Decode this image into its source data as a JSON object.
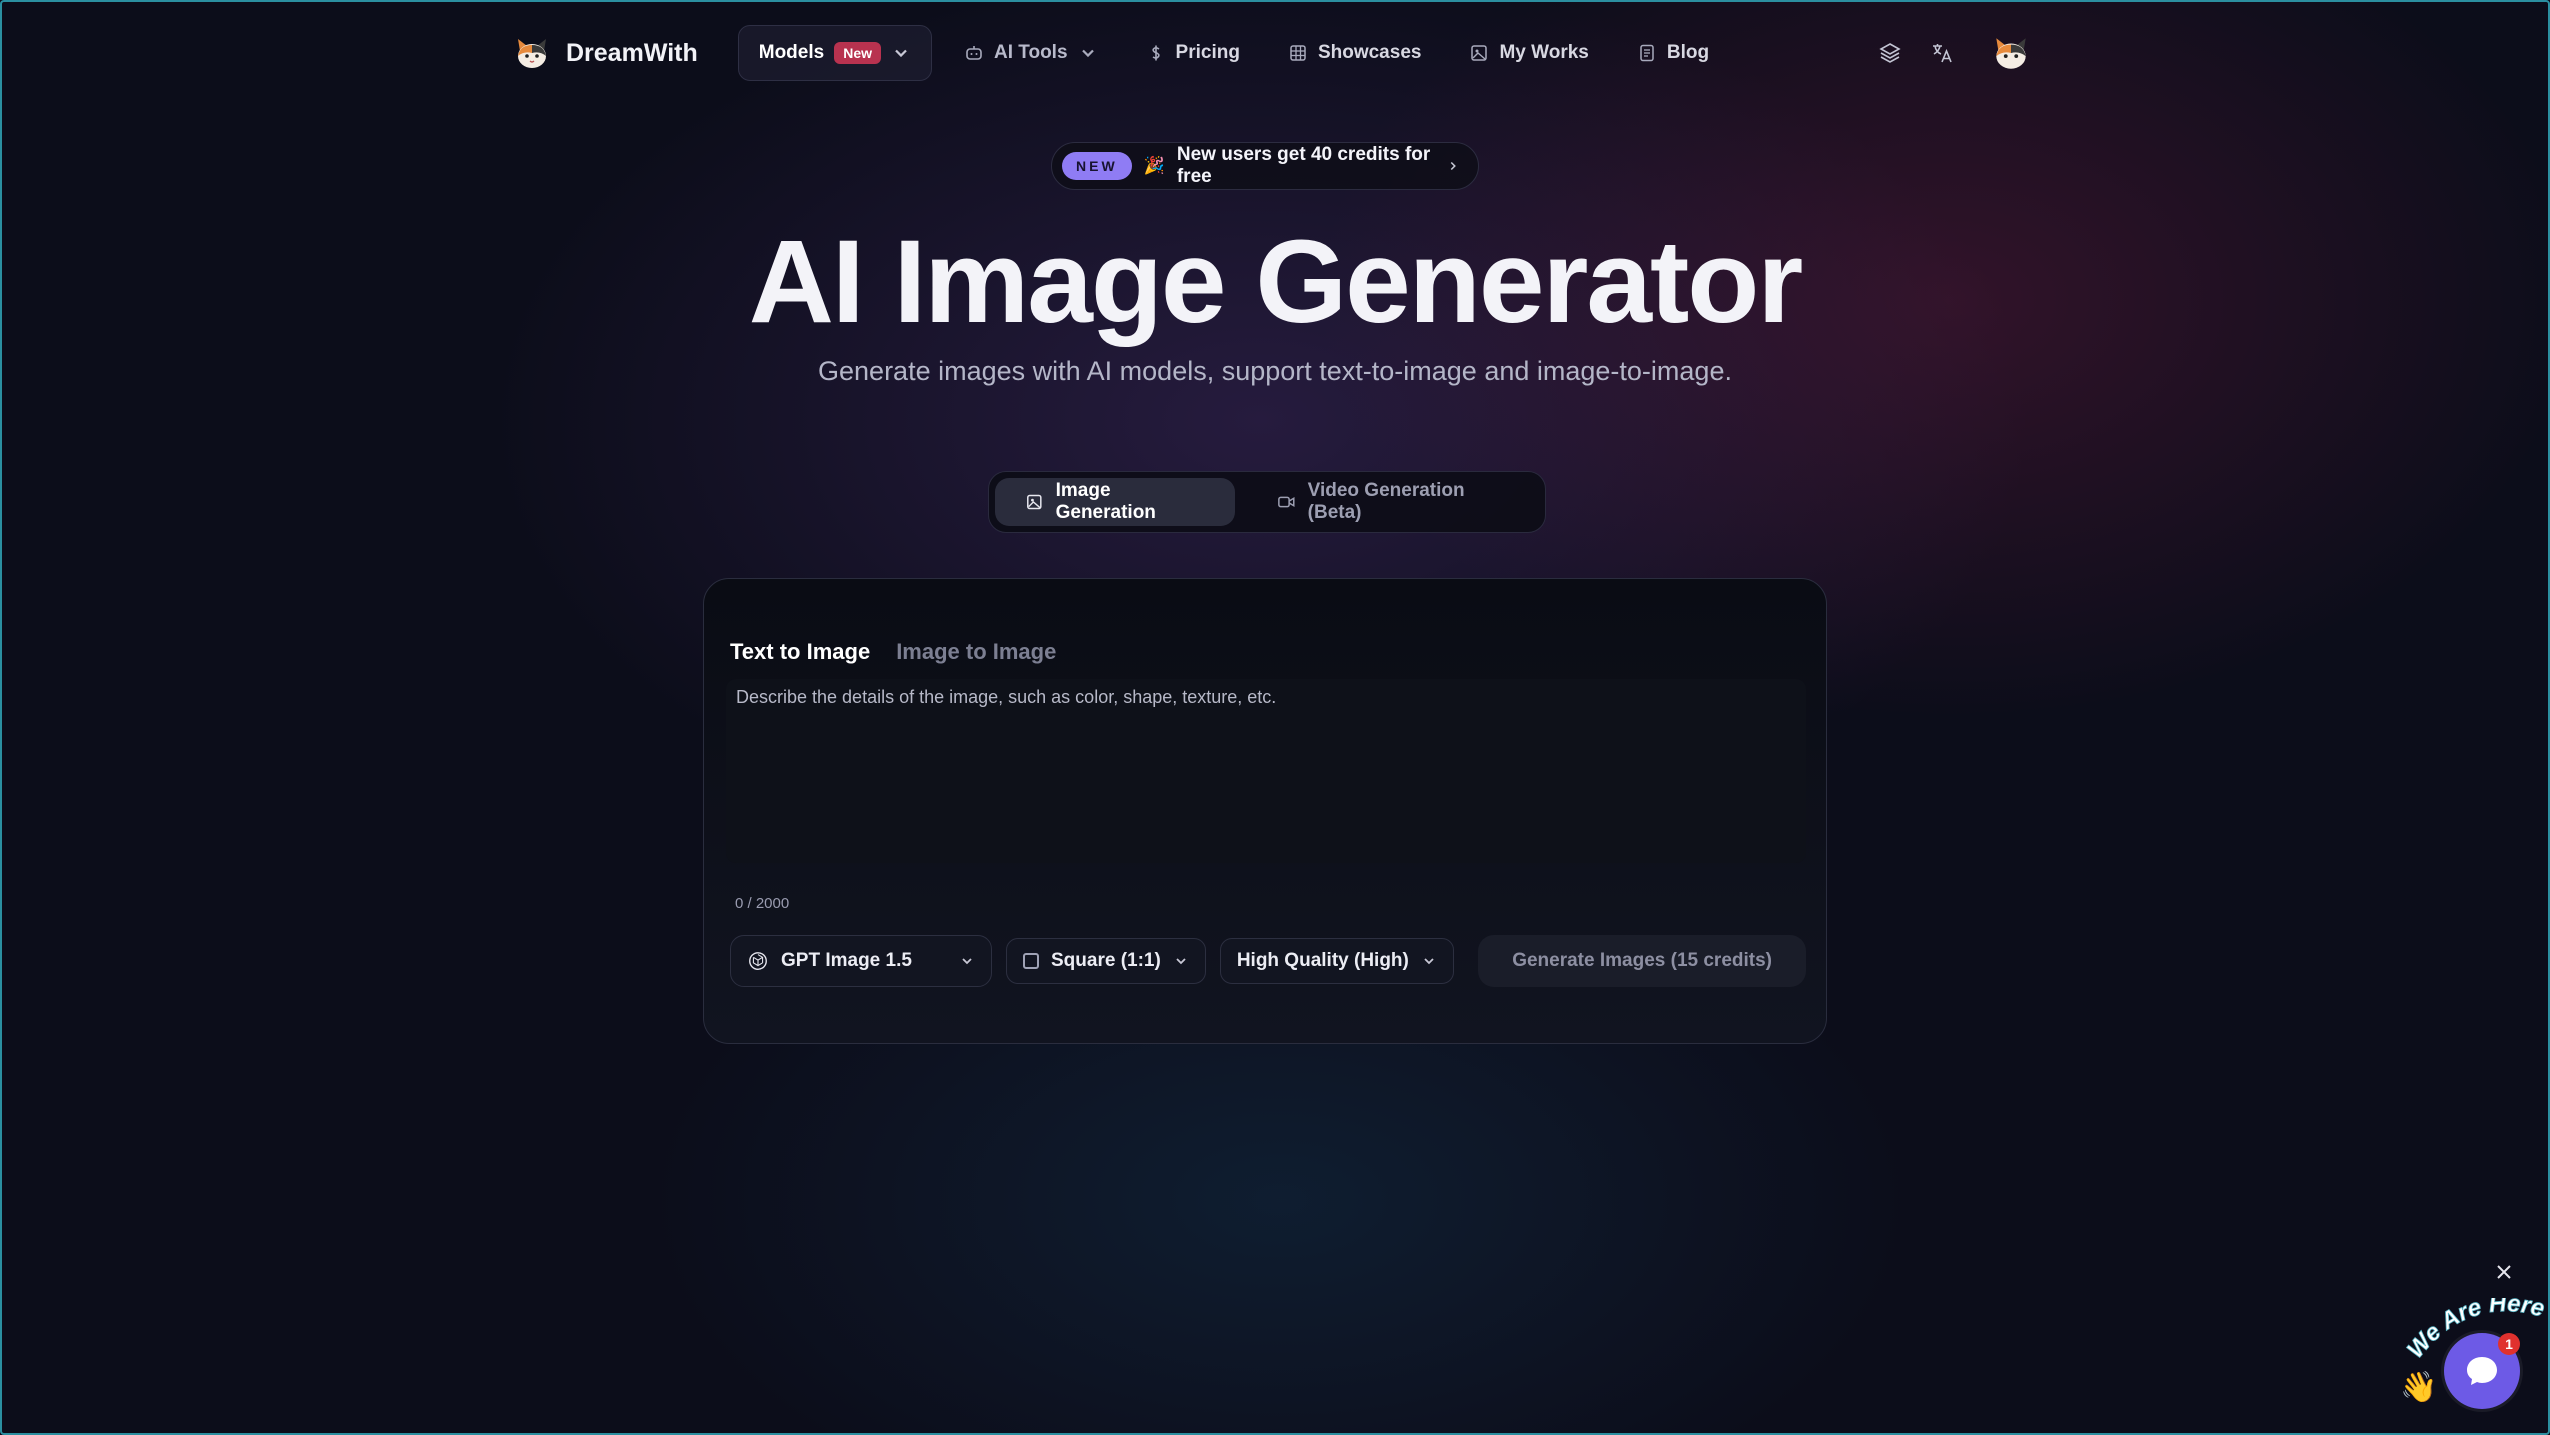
{
  "nav": {
    "brand": "DreamWith",
    "models": {
      "label": "Models",
      "badge": "New"
    },
    "ai_tools": "AI Tools",
    "pricing": "Pricing",
    "showcases": "Showcases",
    "my_works": "My Works",
    "blog": "Blog"
  },
  "promo": {
    "tag": "NEW",
    "emoji": "🎉",
    "text": "New users get 40 credits for free"
  },
  "hero": {
    "title": "AI Image Generator",
    "subtitle": "Generate images with AI models, support text-to-image and image-to-image."
  },
  "mode_tabs": [
    {
      "label": "Image Generation",
      "active": true,
      "icon": "image-icon"
    },
    {
      "label": "Video Generation (Beta)",
      "active": false,
      "icon": "video-icon"
    }
  ],
  "generator": {
    "tabs": [
      {
        "label": "Text to Image",
        "active": true
      },
      {
        "label": "Image to Image",
        "active": false
      }
    ],
    "prompt_placeholder": "Describe the details of the image, such as color, shape, texture, etc.",
    "prompt_value": "",
    "counter": "0 / 2000",
    "model": "GPT Image 1.5",
    "aspect": "Square (1:1)",
    "quality": "High Quality (High)",
    "generate_label": "Generate Images (15 credits)"
  },
  "chat": {
    "label": "We Are Here!",
    "unread": "1"
  },
  "colors": {
    "accent": "#8f7cf4",
    "badge": "#b8324f",
    "chat": "#6d5ae6",
    "background": "#0c0d1a"
  }
}
